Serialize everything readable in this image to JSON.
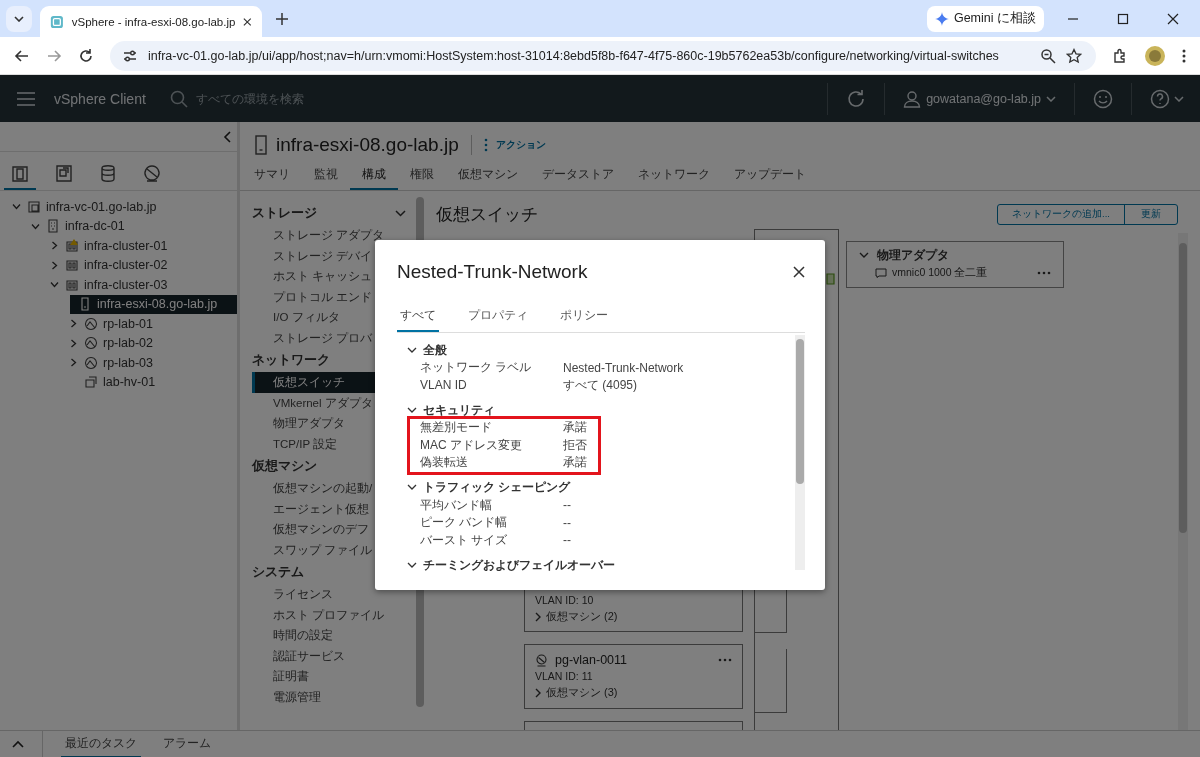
{
  "browser": {
    "tab_title": "vSphere - infra-esxi-08.go-lab.jp",
    "gemini_button": "Gemini に相談",
    "url": "infra-vc-01.go-lab.jp/ui/app/host;nav=h/urn:vmomi:HostSystem:host-31014:8ebd5f8b-f647-4f75-860c-19b5762ea53b/configure/networking/virtual-switches"
  },
  "header": {
    "app_name": "vSphere Client",
    "search_placeholder": "すべての環境を検索",
    "user": "gowatana@go-lab.jp"
  },
  "sidebar": {
    "view_tabs": [
      {
        "kind": "hosts",
        "selected": true
      },
      {
        "kind": "vms",
        "selected": false
      },
      {
        "kind": "storage",
        "selected": false
      },
      {
        "kind": "network",
        "selected": false
      }
    ],
    "tree": [
      {
        "label": "infra-vc-01.go-lab.jp",
        "kind": "vcenter",
        "expanded": true,
        "selected": false,
        "children": [
          {
            "label": "infra-dc-01",
            "kind": "datacenter",
            "expanded": true,
            "selected": false,
            "children": [
              {
                "label": "infra-cluster-01",
                "kind": "cluster-warning",
                "expanded": false,
                "selected": false
              },
              {
                "label": "infra-cluster-02",
                "kind": "cluster",
                "expanded": false,
                "selected": false
              },
              {
                "label": "infra-cluster-03",
                "kind": "cluster",
                "expanded": true,
                "selected": false,
                "children": [
                  {
                    "label": "infra-esxi-08.go-lab.jp",
                    "kind": "host",
                    "selected": true
                  },
                  {
                    "label": "rp-lab-01",
                    "kind": "resource-pool",
                    "expanded": false,
                    "selected": false
                  },
                  {
                    "label": "rp-lab-02",
                    "kind": "resource-pool",
                    "expanded": false,
                    "selected": false
                  },
                  {
                    "label": "rp-lab-03",
                    "kind": "resource-pool",
                    "expanded": false,
                    "selected": false
                  },
                  {
                    "label": "lab-hv-01",
                    "kind": "vapp",
                    "selected": false
                  }
                ]
              }
            ]
          }
        ]
      }
    ]
  },
  "object": {
    "title": "infra-esxi-08.go-lab.jp",
    "actions": "アクション",
    "tabs": [
      {
        "label": "サマリ",
        "selected": false
      },
      {
        "label": "監視",
        "selected": false
      },
      {
        "label": "構成",
        "selected": true
      },
      {
        "label": "権限",
        "selected": false
      },
      {
        "label": "仮想マシン",
        "selected": false
      },
      {
        "label": "データストア",
        "selected": false
      },
      {
        "label": "ネットワーク",
        "selected": false
      },
      {
        "label": "アップデート",
        "selected": false
      }
    ]
  },
  "config_nav": [
    {
      "heading": "ストレージ",
      "items": [
        {
          "label": "ストレージ アダプタ",
          "selected": false
        },
        {
          "label": "ストレージ デバイ",
          "selected": false
        },
        {
          "label": "ホスト キャッシュ",
          "selected": false
        },
        {
          "label": "プロトコル エンド",
          "selected": false
        },
        {
          "label": "I/O フィルタ",
          "selected": false
        },
        {
          "label": "ストレージ プロバ",
          "selected": false
        }
      ]
    },
    {
      "heading": "ネットワーク",
      "items": [
        {
          "label": "仮想スイッチ",
          "selected": true
        },
        {
          "label": "VMkernel アダプタ",
          "selected": false
        },
        {
          "label": "物理アダプタ",
          "selected": false
        },
        {
          "label": "TCP/IP 設定",
          "selected": false
        }
      ]
    },
    {
      "heading": "仮想マシン",
      "items": [
        {
          "label": "仮想マシンの起動/",
          "selected": false
        },
        {
          "label": "エージェント仮想",
          "selected": false
        },
        {
          "label": "仮想マシンのデフ",
          "selected": false
        },
        {
          "label": "スワップ ファイル",
          "selected": false
        }
      ]
    },
    {
      "heading": "システム",
      "items": [
        {
          "label": "ライセンス",
          "selected": false
        },
        {
          "label": "ホスト プロファイル",
          "selected": false
        },
        {
          "label": "時間の設定",
          "selected": false
        },
        {
          "label": "認証サービス",
          "selected": false
        },
        {
          "label": "証明書",
          "selected": false
        },
        {
          "label": "電源管理",
          "selected": false
        }
      ]
    }
  ],
  "content": {
    "title": "仮想スイッチ",
    "buttons": [
      "ネットワークの追加...",
      "更新"
    ],
    "port_groups": [
      {
        "vlan": "VLAN ID: 10",
        "vms": "仮想マシン (2)"
      },
      {
        "name": "pg-vlan-0011",
        "vlan": "VLAN ID: 11",
        "vms": "仮想マシン (3)"
      }
    ],
    "physical_adapters": {
      "title": "物理アダプタ",
      "items": [
        "vmnic0 1000 全二重"
      ]
    }
  },
  "dialog": {
    "title": "Nested-Trunk-Network",
    "tabs": [
      {
        "label": "すべて",
        "selected": true
      },
      {
        "label": "プロパティ",
        "selected": false
      },
      {
        "label": "ポリシー",
        "selected": false
      }
    ],
    "sections": [
      {
        "title": "全般",
        "expanded": true,
        "highlighted": false,
        "rows": [
          {
            "label": "ネットワーク ラベル",
            "value": "Nested-Trunk-Network"
          },
          {
            "label": "VLAN ID",
            "value": "すべて (4095)"
          }
        ]
      },
      {
        "title": "セキュリティ",
        "expanded": true,
        "highlighted": true,
        "rows": [
          {
            "label": "無差別モード",
            "value": "承諾"
          },
          {
            "label": "MAC アドレス変更",
            "value": "拒否"
          },
          {
            "label": "偽装転送",
            "value": "承諾"
          }
        ]
      },
      {
        "title": "トラフィック シェーピング",
        "expanded": true,
        "highlighted": false,
        "rows": [
          {
            "label": "平均バンド幅",
            "value": "--"
          },
          {
            "label": "ピーク バンド幅",
            "value": "--"
          },
          {
            "label": "バースト サイズ",
            "value": "--"
          }
        ]
      },
      {
        "title": "チーミングおよびフェイルオーバー",
        "expanded": true
      }
    ]
  },
  "bottom_bar": {
    "tabs": [
      {
        "label": "最近のタスク",
        "selected": true
      },
      {
        "label": "アラーム",
        "selected": false
      }
    ]
  }
}
